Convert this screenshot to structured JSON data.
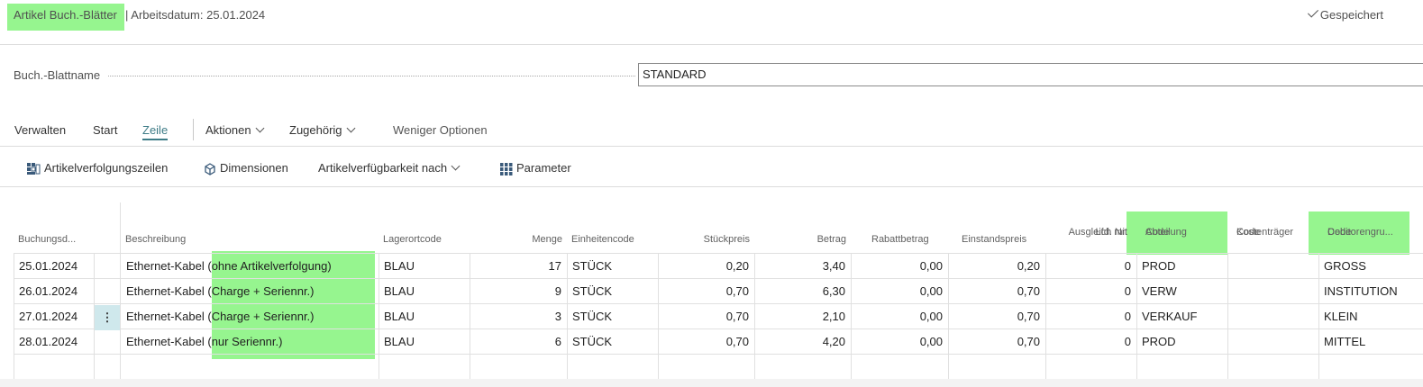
{
  "header": {
    "title": "Artikel Buch.-Blätter",
    "workdate": "| Arbeitsdatum: 25.01.2024",
    "saved": "Gespeichert"
  },
  "batch": {
    "label": "Buch.-Blattname",
    "value": "STANDARD"
  },
  "tabs": {
    "manage": "Verwalten",
    "start": "Start",
    "line": "Zeile",
    "actions": "Aktionen",
    "related": "Zugehörig",
    "fewer": "Weniger Optionen"
  },
  "toolbar": {
    "tracking": "Artikelverfolgungszeilen",
    "dimensions": "Dimensionen",
    "availability": "Artikelverfügbarkeit nach",
    "parameters": "Parameter"
  },
  "columns": {
    "posting_date": "Buchungsd...",
    "description": "Beschreibung",
    "location": "Lagerortcode",
    "quantity": "Menge",
    "unit": "Einheitencode",
    "unit_price": "Stückpreis",
    "amount": "Betrag",
    "discount": "Rabattbetrag",
    "unit_cost": "Einstandspreis",
    "applies_to_1": "Ausgleich mit",
    "applies_to_2": "Lfd. Nr.",
    "department_1": "Abteilung",
    "department_2": "Code",
    "costcarrier_1": "Kostenträger",
    "costcarrier_2": "Code",
    "custgroup_1": "Debitorengru...",
    "custgroup_2": "Code"
  },
  "rows": [
    {
      "date": "25.01.2024",
      "desc_a": "Ethernet-Kabel",
      "desc_b": "(ohne Artikelverfolgung)",
      "loc": "BLAU",
      "qty": "17",
      "unit": "STÜCK",
      "price": "0,20",
      "amount": "3,40",
      "discount": "0,00",
      "cost": "0,20",
      "applies": "0",
      "dept": "PROD",
      "cc": "",
      "cust": "GROSS"
    },
    {
      "date": "26.01.2024",
      "desc_a": "Ethernet-Kabel",
      "desc_b": "(Charge + Seriennr.)",
      "loc": "BLAU",
      "qty": "9",
      "unit": "STÜCK",
      "price": "0,70",
      "amount": "6,30",
      "discount": "0,00",
      "cost": "0,70",
      "applies": "0",
      "dept": "VERW",
      "cc": "",
      "cust": "INSTITUTION"
    },
    {
      "date": "27.01.2024",
      "desc_a": "Ethernet-Kabel",
      "desc_b": "(Charge + Seriennr.)",
      "loc": "BLAU",
      "qty": "3",
      "unit": "STÜCK",
      "price": "0,70",
      "amount": "2,10",
      "discount": "0,00",
      "cost": "0,70",
      "applies": "0",
      "dept": "VERKAUF",
      "cc": "",
      "cust": "KLEIN"
    },
    {
      "date": "28.01.2024",
      "desc_a": "Ethernet-Kabel",
      "desc_b": "(nur Seriennr.)",
      "loc": "BLAU",
      "qty": "6",
      "unit": "STÜCK",
      "price": "0,70",
      "amount": "4,20",
      "discount": "0,00",
      "cost": "0,70",
      "applies": "0",
      "dept": "PROD",
      "cc": "",
      "cust": "MITTEL"
    }
  ],
  "row_menu_icon": "more-vertical-icon",
  "highlight_color": "#96f58f",
  "accent_color": "#3d7b86"
}
